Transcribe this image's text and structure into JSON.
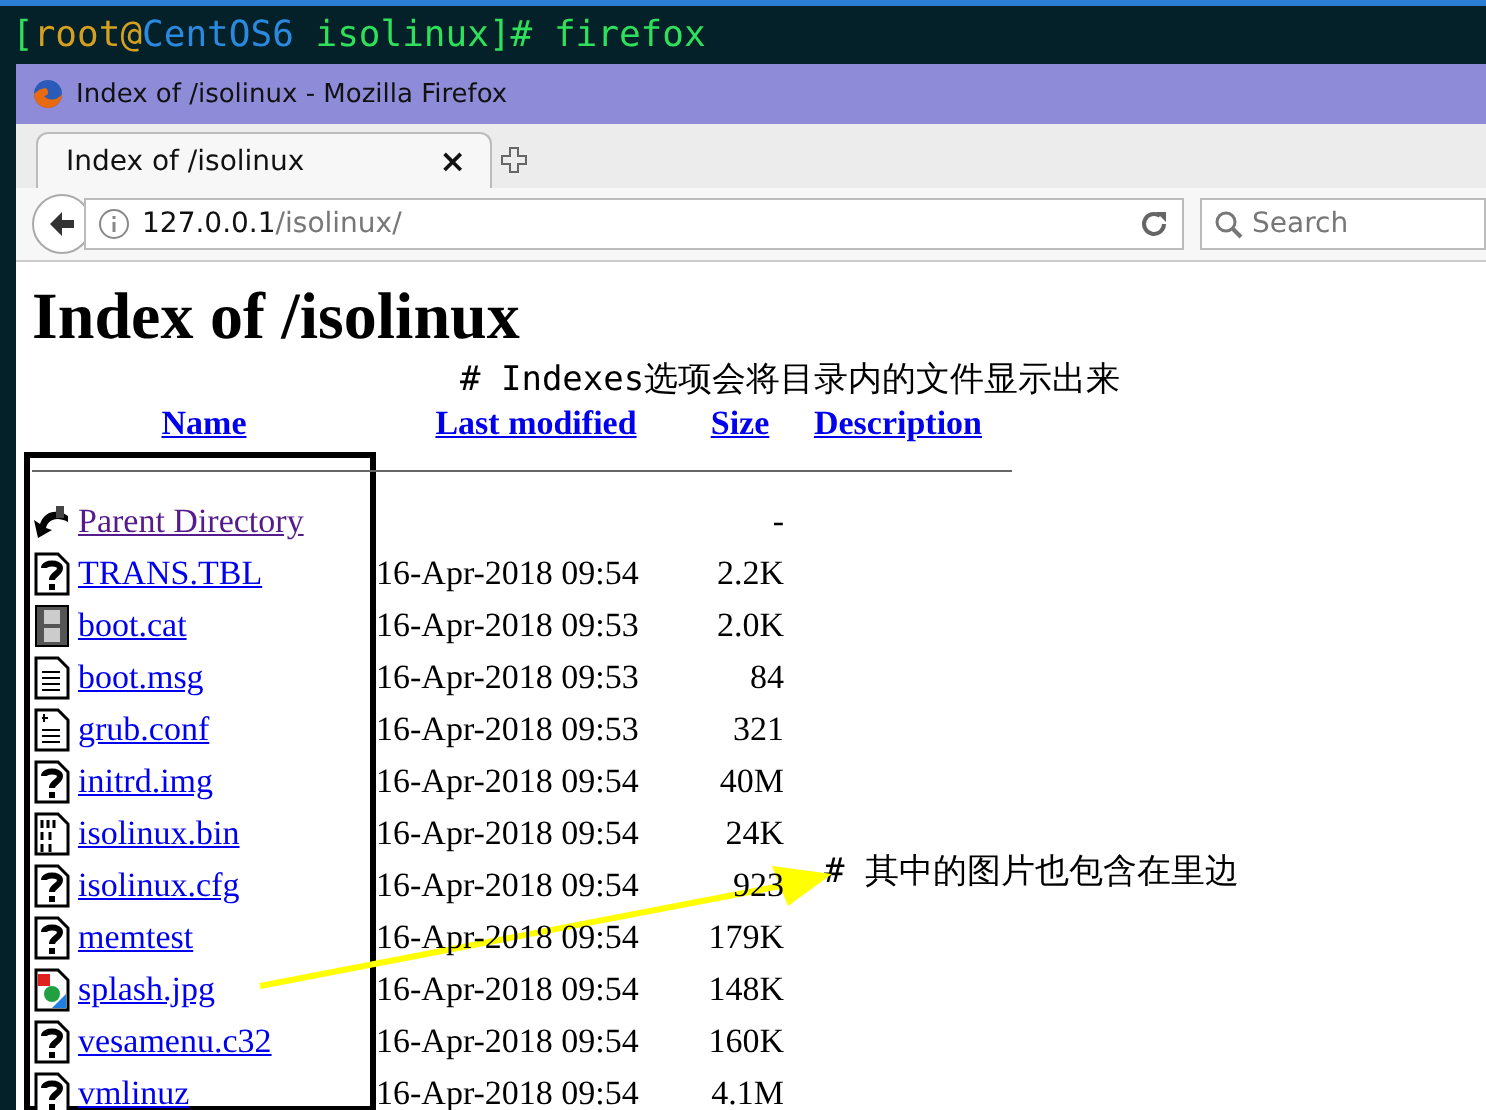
{
  "terminal": {
    "prompt": [
      {
        "kind": "bracket",
        "text": "["
      },
      {
        "kind": "user",
        "text": "root"
      },
      {
        "kind": "at",
        "text": "@"
      },
      {
        "kind": "host",
        "text": "CentOS6"
      },
      {
        "kind": "path",
        "text": " isolinux]# firefox"
      }
    ]
  },
  "window": {
    "title": "Index of /isolinux - Mozilla Firefox"
  },
  "tabs": [
    {
      "label": "Index of /isolinux",
      "selected": true,
      "close": "×"
    }
  ],
  "url": {
    "host": "127.0.0.1",
    "path": "/isolinux/"
  },
  "search": {
    "placeholder": "Search"
  },
  "page": {
    "heading": "Index of /isolinux",
    "note": "# Indexes选项会将目录内的文件显示出来",
    "columns": [
      "Name",
      "Last modified",
      "Size",
      "Description"
    ],
    "rows": [
      {
        "kind": "back",
        "name": "Parent Directory",
        "visited": true,
        "modified": "",
        "size": "-"
      },
      {
        "kind": "unknown",
        "name": "TRANS.TBL",
        "visited": false,
        "modified": "16-Apr-2018 09:54",
        "size": "2.2K"
      },
      {
        "kind": "movie",
        "name": "boot.cat",
        "visited": false,
        "modified": "16-Apr-2018 09:53",
        "size": "2.0K"
      },
      {
        "kind": "text",
        "name": "boot.msg",
        "visited": false,
        "modified": "16-Apr-2018 09:53",
        "size": "84"
      },
      {
        "kind": "script",
        "name": "grub.conf",
        "visited": false,
        "modified": "16-Apr-2018 09:53",
        "size": "321"
      },
      {
        "kind": "unknown",
        "name": "initrd.img",
        "visited": false,
        "modified": "16-Apr-2018 09:54",
        "size": "40M"
      },
      {
        "kind": "binary",
        "name": "isolinux.bin",
        "visited": false,
        "modified": "16-Apr-2018 09:54",
        "size": "24K"
      },
      {
        "kind": "unknown",
        "name": "isolinux.cfg",
        "visited": false,
        "modified": "16-Apr-2018 09:54",
        "size": "923"
      },
      {
        "kind": "unknown",
        "name": "memtest",
        "visited": false,
        "modified": "16-Apr-2018 09:54",
        "size": "179K"
      },
      {
        "kind": "image",
        "name": "splash.jpg",
        "visited": false,
        "modified": "16-Apr-2018 09:54",
        "size": "148K"
      },
      {
        "kind": "unknown",
        "name": "vesamenu.c32",
        "visited": false,
        "modified": "16-Apr-2018 09:54",
        "size": "160K"
      },
      {
        "kind": "unknown",
        "name": "vmlinuz",
        "visited": false,
        "modified": "16-Apr-2018 09:54",
        "size": "4.1M"
      }
    ],
    "callout": "# 其中的图片也包含在里边"
  }
}
